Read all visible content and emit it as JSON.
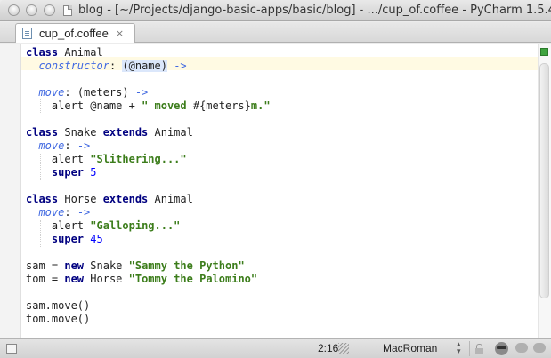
{
  "window": {
    "title": "blog - [~/Projects/django-basic-apps/basic/blog] - .../cup_of.coffee - PyCharm 1.5.4"
  },
  "tab": {
    "label": "cup_of.coffee",
    "close_glyph": "×"
  },
  "code": {
    "l1": {
      "kw": "class",
      "rest": " Animal"
    },
    "l2": {
      "indent": "  ",
      "fn": "constructor",
      "colon": ": ",
      "param": "(@name)",
      "arrow": " ->"
    },
    "l4": {
      "indent": "  ",
      "fn": "move",
      "colon": ": ",
      "args": "(meters)",
      "arrow": " ->"
    },
    "l5": {
      "indent": "    ",
      "text1": "alert @name + ",
      "str1": "\" moved ",
      "interp": "#{meters}",
      "str2": "m.\""
    },
    "l7": {
      "kw1": "class",
      "mid": " Snake ",
      "kw2": "extends",
      "rest": " Animal"
    },
    "l8": {
      "indent": "  ",
      "fn": "move",
      "colon": ": ",
      "arrow": "->"
    },
    "l9": {
      "indent": "    ",
      "text": "alert ",
      "str": "\"Slithering...\""
    },
    "l10": {
      "indent": "    ",
      "kw": "super",
      "num": " 5"
    },
    "l12": {
      "kw1": "class",
      "mid": " Horse ",
      "kw2": "extends",
      "rest": " Animal"
    },
    "l13": {
      "indent": "  ",
      "fn": "move",
      "colon": ": ",
      "arrow": "->"
    },
    "l14": {
      "indent": "    ",
      "text": "alert ",
      "str": "\"Galloping...\""
    },
    "l15": {
      "indent": "    ",
      "kw": "super",
      "num": " 45"
    },
    "l17": {
      "text": "sam = ",
      "kw": "new",
      "mid": " Snake ",
      "str": "\"Sammy the Python\""
    },
    "l18": {
      "text": "tom = ",
      "kw": "new",
      "mid": " Horse ",
      "str": "\"Tommy the Palomino\""
    },
    "l20": {
      "text": "sam.move()"
    },
    "l21": {
      "text": "tom.move()"
    }
  },
  "status": {
    "position": "2:16",
    "encoding": "MacRoman",
    "encoding_arrows": "▲▼"
  },
  "icons": [
    "document-icon",
    "lock-icon",
    "inspector-icon",
    "event-log-icon"
  ]
}
